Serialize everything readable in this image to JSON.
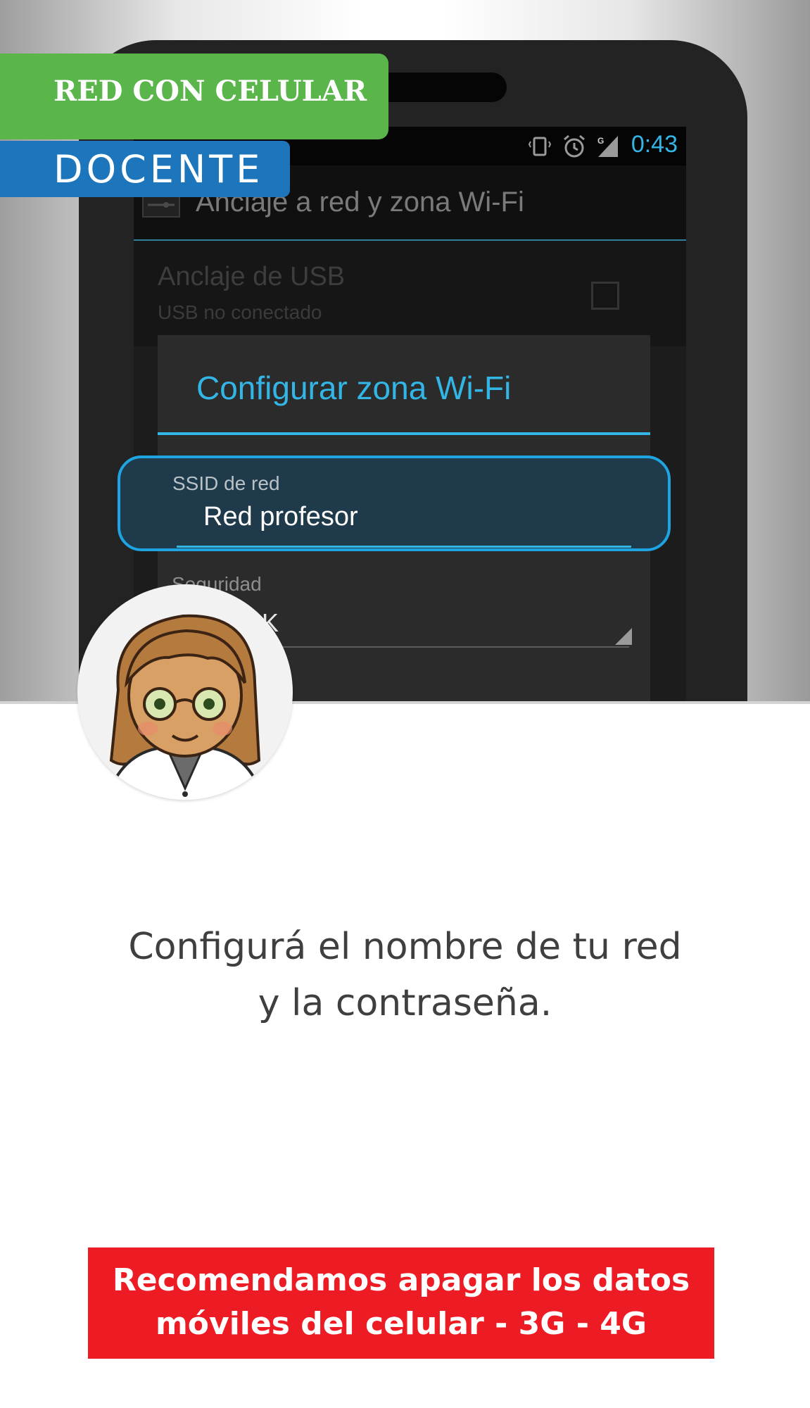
{
  "badges": {
    "category": "RED CON CELULAR",
    "audience": "DOCENTE"
  },
  "phone": {
    "status_time": "0:43",
    "actionbar_title": "Anclaje a red y zona Wi-Fi",
    "usb_title": "Anclaje de USB",
    "usb_subtitle": "USB no conectado",
    "dialog_title": "Configurar zona Wi-Fi",
    "ssid_label": "SSID de red",
    "ssid_value": "Red profesor",
    "security_label": "Seguridad",
    "security_value": "PSK",
    "accent_color": "#33b5e5"
  },
  "instruction": {
    "line1": "Configurá el nombre de tu red",
    "line2": "y la contraseña."
  },
  "notice": {
    "line1": "Recomendamos apagar los datos",
    "line2": "móviles del celular - 3G - 4G",
    "color": "#ed1c24"
  }
}
